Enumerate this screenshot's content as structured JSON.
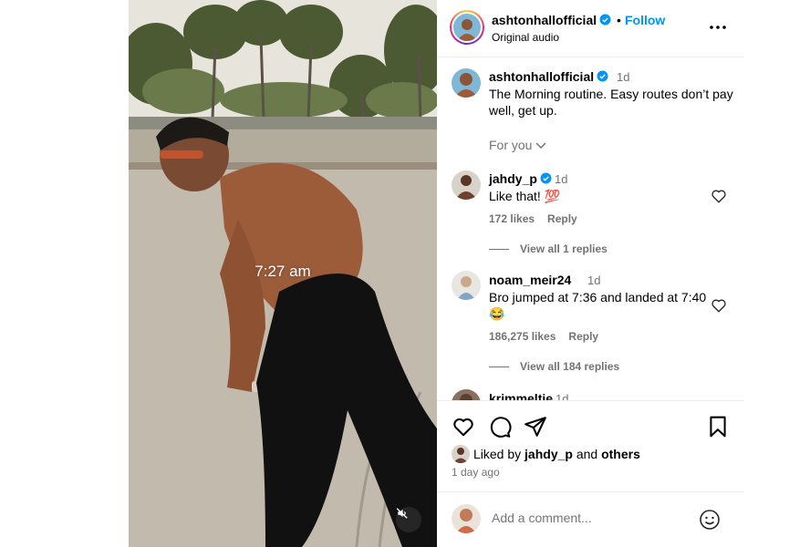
{
  "video": {
    "overlay_time": "7:27 am",
    "mute_icon": "volume-muted-icon"
  },
  "header": {
    "username": "ashtonhallofficial",
    "separator": "•",
    "follow_label": "Follow",
    "audio_label": "Original audio",
    "more_icon": "more-options-icon"
  },
  "caption": {
    "username": "ashtonhallofficial",
    "time": "1d",
    "text": "The Morning routine. Easy routes don’t pay well, get up.",
    "for_you_label": "For you"
  },
  "comments": [
    {
      "username": "jahdy_p",
      "verified": true,
      "time": "1d",
      "text": "Like that! 💯",
      "likes": "172 likes",
      "reply_label": "Reply",
      "view_replies": "View all 1 replies"
    },
    {
      "username": "noam_meir24",
      "verified": false,
      "time": "1d",
      "text": "Bro jumped at 7:36 and landed at 7:40😂",
      "likes": "186,275 likes",
      "reply_label": "Reply",
      "view_replies": "View all 184 replies"
    },
    {
      "username": "krimmeltie",
      "verified": false,
      "time": "1d"
    }
  ],
  "actions": {
    "liked_by_prefix": "Liked by",
    "liked_by_user": "jahdy_p",
    "liked_by_and": "and",
    "liked_by_others": "others",
    "date": "1 day ago"
  },
  "comment_box": {
    "placeholder": "Add a comment..."
  },
  "colors": {
    "accent": "#0095f6",
    "muted_text": "#737373",
    "border": "#dbdbdb"
  }
}
